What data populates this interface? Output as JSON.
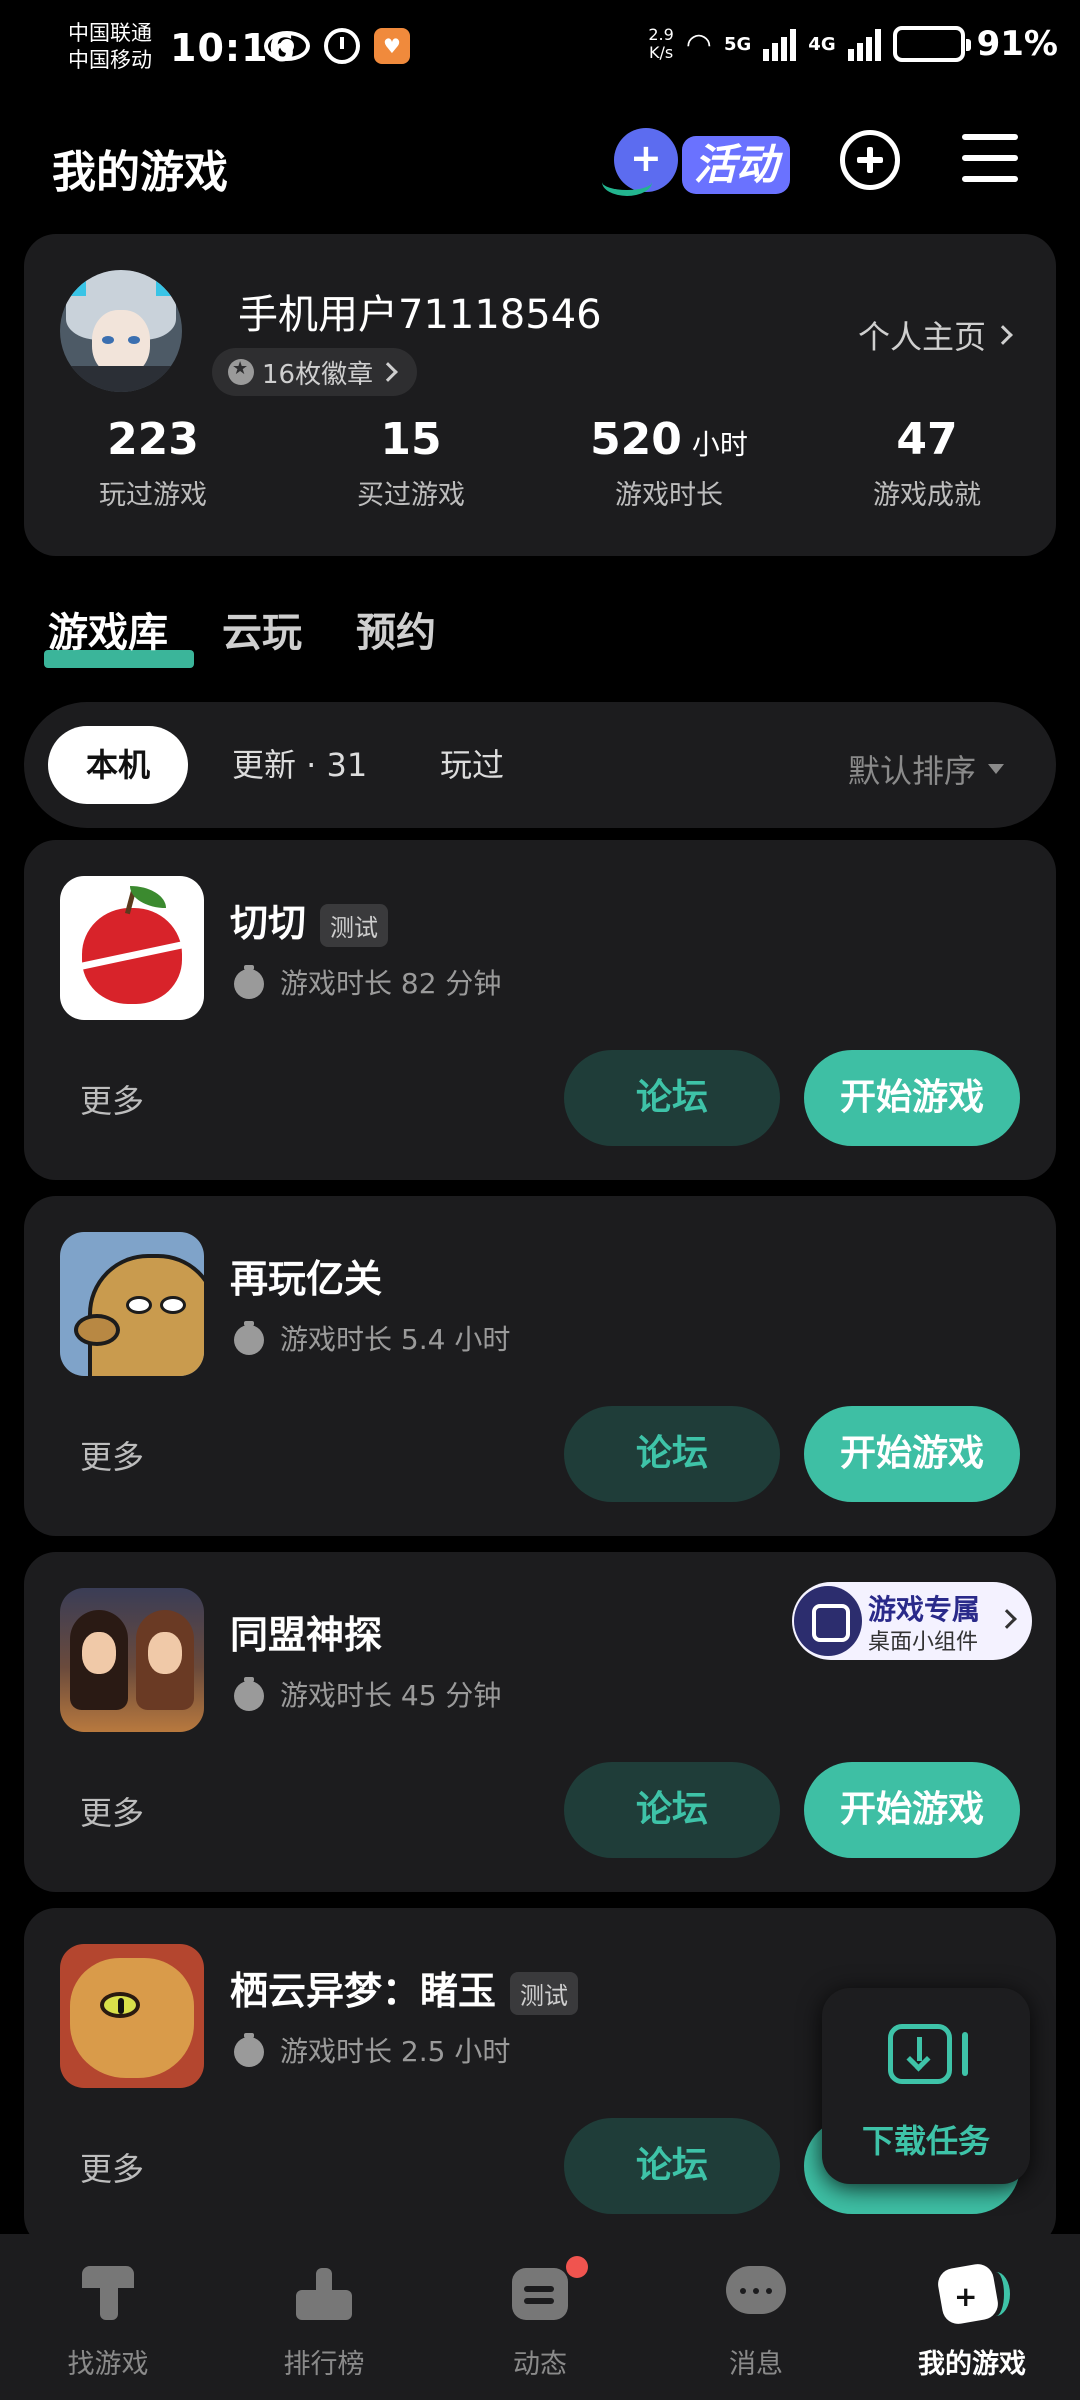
{
  "status_bar": {
    "carrier_1": "中国联通",
    "carrier_2": "中国移动",
    "time": "10:16",
    "speed_value": "2.9",
    "speed_unit": "K/s",
    "network_5g": "5G",
    "network_4g": "4G",
    "battery_percent": 91,
    "battery_text": "91%"
  },
  "header": {
    "title": "我的游戏",
    "activity_label": "活动",
    "icons": [
      "activity-icon",
      "add-icon",
      "menu-icon"
    ]
  },
  "profile": {
    "username": "手机用户71118546",
    "badges": "16枚徽章",
    "homepage_link": "个人主页",
    "stats": [
      {
        "value": "223",
        "unit": "",
        "label": "玩过游戏"
      },
      {
        "value": "15",
        "unit": "",
        "label": "买过游戏"
      },
      {
        "value": "520",
        "unit": "小时",
        "label": "游戏时长"
      },
      {
        "value": "47",
        "unit": "",
        "label": "游戏成就"
      }
    ]
  },
  "main_tabs": [
    {
      "label": "游戏库",
      "active": true
    },
    {
      "label": "云玩",
      "active": false
    },
    {
      "label": "预约",
      "active": false
    }
  ],
  "filters": {
    "chips": [
      {
        "label": "本机",
        "active": true
      },
      {
        "label": "更新 · 31",
        "active": false
      },
      {
        "label": "玩过",
        "active": false
      }
    ],
    "sort_label": "默认排序"
  },
  "games": [
    {
      "name": "切切",
      "tag": "测试",
      "playtime": "游戏时长 82 分钟",
      "more": "更多",
      "forum": "论坛",
      "play": "开始游戏",
      "icon": "apple-icon"
    },
    {
      "name": "再玩亿关",
      "tag": "",
      "playtime": "游戏时长 5.4 小时",
      "more": "更多",
      "forum": "论坛",
      "play": "开始游戏",
      "icon": "seal-icon"
    },
    {
      "name": "同盟神探",
      "tag": "",
      "playtime": "游戏时长 45 分钟",
      "more": "更多",
      "forum": "论坛",
      "play": "开始游戏",
      "icon": "detective-icon"
    },
    {
      "name": "栖云异梦：睹玉",
      "tag": "测试",
      "playtime": "游戏时长 2.5 小时",
      "more": "更多",
      "forum": "论坛",
      "play": "开始游戏",
      "icon": "lion-icon"
    }
  ],
  "widget_promo": {
    "title": "游戏专属",
    "subtitle": "桌面小组件"
  },
  "download_task": {
    "label": "下载任务"
  },
  "bottom_nav": [
    {
      "label": "找游戏",
      "icon": "find-game-icon",
      "active": false
    },
    {
      "label": "排行榜",
      "icon": "ranking-icon",
      "active": false
    },
    {
      "label": "动态",
      "icon": "feed-icon",
      "active": false,
      "has_dot": true
    },
    {
      "label": "消息",
      "icon": "message-icon",
      "active": false
    },
    {
      "label": "我的游戏",
      "icon": "my-games-icon",
      "active": true
    }
  ],
  "colors": {
    "accent": "#3ebfa4",
    "forum_bg": "#1f3d39",
    "card_bg": "#1c1c1e",
    "page_bg": "#000000",
    "activity_purple": "#6a72ff"
  }
}
